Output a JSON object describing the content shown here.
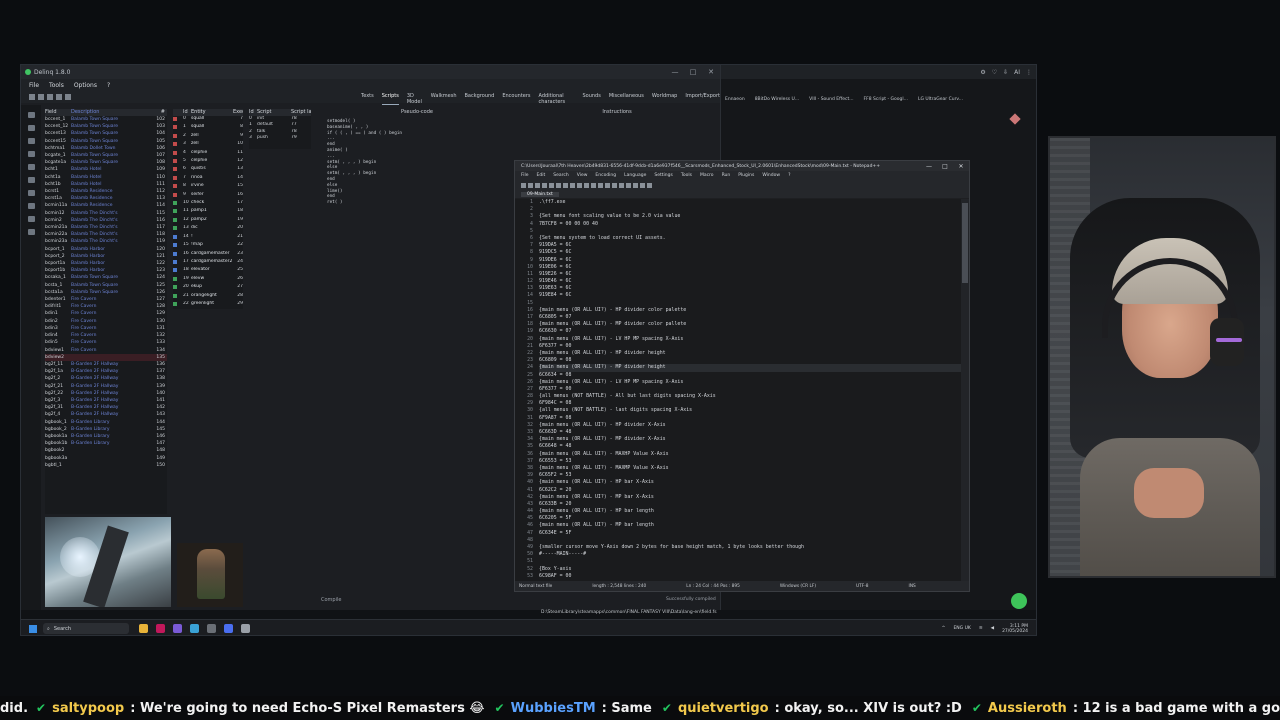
{
  "delinq": {
    "title": "Delinq 1.8.0",
    "menu": [
      "File",
      "Tools",
      "Options",
      "?"
    ],
    "tabs": [
      "Texts",
      "Scripts",
      "3D Model",
      "Walkmesh",
      "Background",
      "Encounters",
      "Additional characters",
      "Sounds",
      "Miscellaneous",
      "Worldmap",
      "Import/Export"
    ],
    "list1_headers": [
      "Field",
      "Description",
      "#"
    ],
    "list1_rows": [
      [
        "bccent_1",
        "Balamb Town Square",
        "102"
      ],
      [
        "bccent_12",
        "Balamb Town Square",
        "103"
      ],
      [
        "bccent13",
        "Balamb Town Square",
        "104"
      ],
      [
        "bccent15",
        "Balamb Town Square",
        "105"
      ],
      [
        "bchtma1",
        "Balamb Dollet Town",
        "106"
      ],
      [
        "bcgate_1",
        "Balamb Town Square",
        "107"
      ],
      [
        "bcgate1a",
        "Balamb Town Square",
        "108"
      ],
      [
        "bcht1",
        "Balamb Hotel",
        "109"
      ],
      [
        "bcht1a",
        "Balamb Hotel",
        "110"
      ],
      [
        "bcht1b",
        "Balamb Hotel",
        "111"
      ],
      [
        "bcrst1",
        "Balamb Residence",
        "112"
      ],
      [
        "bcrst1a",
        "Balamb Residence",
        "113"
      ],
      [
        "bcmin11a",
        "Balamb Residence",
        "114"
      ],
      [
        "bcmin12",
        "Balamb The Dincht's",
        "115"
      ],
      [
        "bcmin2",
        "Balamb The Dincht's",
        "116"
      ],
      [
        "bcmin21a",
        "Balamb The Dincht's",
        "117"
      ],
      [
        "bcmin22a",
        "Balamb The Dincht's",
        "118"
      ],
      [
        "bcmin23a",
        "Balamb The Dincht's",
        "119"
      ],
      [
        "bcport_1",
        "Balamb Harbor",
        "120"
      ],
      [
        "bcport_2",
        "Balamb Harbor",
        "121"
      ],
      [
        "bcport1a",
        "Balamb Harbor",
        "122"
      ],
      [
        "bcport1b",
        "Balamb Harbor",
        "123"
      ],
      [
        "bcsaka_1",
        "Balamb Town Square",
        "124"
      ],
      [
        "bcsta_1",
        "Balamb Town Square",
        "125"
      ],
      [
        "bcsta1a",
        "Balamb Town Square",
        "126"
      ],
      [
        "bdenter1",
        "Fire Cavern",
        "127"
      ],
      [
        "bdifrit1",
        "Fire Cavern",
        "128"
      ],
      [
        "bdin1",
        "Fire Cavern",
        "129"
      ],
      [
        "bdin2",
        "Fire Cavern",
        "130"
      ],
      [
        "bdin3",
        "Fire Cavern",
        "131"
      ],
      [
        "bdin4",
        "Fire Cavern",
        "132"
      ],
      [
        "bdin5",
        "Fire Cavern",
        "133"
      ],
      [
        "bdview1",
        "Fire Cavern",
        "134"
      ],
      [
        "bdview2",
        "",
        "135"
      ],
      [
        "bg2f_11",
        "B-Garden 2F Hallway",
        "136"
      ],
      [
        "bg2f_1a",
        "B-Garden 2F Hallway",
        "137"
      ],
      [
        "bg2f_2",
        "B-Garden 2F Hallway",
        "138"
      ],
      [
        "bg2f_21",
        "B-Garden 2F Hallway",
        "139"
      ],
      [
        "bg2f_22",
        "B-Garden 2F Hallway",
        "140"
      ],
      [
        "bg2f_3",
        "B-Garden 2F Hallway",
        "141"
      ],
      [
        "bg2f_31",
        "B-Garden 2F Hallway",
        "142"
      ],
      [
        "bg2f_4",
        "B-Garden 2F Hallway",
        "143"
      ],
      [
        "bgbook_1",
        "B-Garden Library",
        "144"
      ],
      [
        "bgbook_2",
        "B-Garden Library",
        "145"
      ],
      [
        "bgbook1a",
        "B-Garden Library",
        "146"
      ],
      [
        "bgbook1b",
        "B-Garden Library",
        "147"
      ],
      [
        "bgbook2",
        "",
        "148"
      ],
      [
        "bgbook3a",
        "",
        "149"
      ],
      [
        "bgbtl_1",
        "",
        "150"
      ]
    ],
    "list2_headers": [
      "Id",
      "Entity",
      "Exec"
    ],
    "list2_rows": [
      [
        "r",
        "0",
        "squall",
        "7"
      ],
      [
        "r",
        "1",
        "squall",
        "8"
      ],
      [
        "r",
        "2",
        "zell",
        "9"
      ],
      [
        "r",
        "3",
        "zell",
        "10"
      ],
      [
        "r",
        "4",
        "celphie",
        "11"
      ],
      [
        "r",
        "5",
        "celphie",
        "12"
      ],
      [
        "r",
        "6",
        "quistis",
        "13"
      ],
      [
        "r",
        "7",
        "rinoa",
        "14"
      ],
      [
        "r",
        "8",
        "irvine",
        "15"
      ],
      [
        "r",
        "9",
        "seifer",
        "16"
      ],
      [
        "g",
        "10",
        "check",
        "17"
      ],
      [
        "g",
        "11",
        "pamp1",
        "18"
      ],
      [
        "g",
        "12",
        "pamp2",
        "19"
      ],
      [
        "g",
        "13",
        "dic",
        "20"
      ],
      [
        "b",
        "14",
        "!",
        "21"
      ],
      [
        "b",
        "15",
        "!map",
        "22"
      ],
      [
        "b",
        "16",
        "cardgamemaster",
        "23"
      ],
      [
        "b",
        "17",
        "cardgamemaster2",
        "24"
      ],
      [
        "b",
        "18",
        "elevator",
        "25"
      ],
      [
        "g",
        "19",
        "elevw",
        "26"
      ],
      [
        "g",
        "20",
        "ekup",
        "27"
      ],
      [
        "g",
        "21",
        "orangelight",
        "28"
      ],
      [
        "g",
        "22",
        "greenlight",
        "29"
      ],
      [
        "g",
        "23",
        "elvtexe",
        "30"
      ]
    ],
    "list3_headers": [
      "Id",
      "Script",
      "Script label"
    ],
    "list3_rows": [
      [
        "0",
        "init",
        "78"
      ],
      [
        "1",
        "default",
        "77"
      ],
      [
        "2",
        "talk",
        "78"
      ],
      [
        "3",
        "push",
        "79"
      ]
    ],
    "panel_headers": [
      "Pseudo-code",
      "Instructions"
    ],
    "pseudo_lines": [
      "setmodel( )",
      "baseanime( , , )",
      "if ( ( , ) == ) and ( )  begin",
      "   ...",
      "end",
      "  anime( )",
      "  ...",
      "    setm( , , , )  begin",
      "    else",
      "    setm( , , , )  begin",
      "  end",
      "  else",
      "  lime()",
      "end",
      "ret( )"
    ],
    "compile_label": "Compile",
    "path_status": "Successfully compiled",
    "path": "D:\\SteamLibrary\\steamapps\\common\\FINAL FANTASY VIII\\Data\\lang-en\\field.fs"
  },
  "browser": {
    "bookmarks": [
      "Ennaeon",
      "8BitDo Wireless U...",
      "VIII - Sound Effect...",
      "FF8 Script - Googl...",
      "LG UltraGear Curv..."
    ]
  },
  "notepad": {
    "title": "C:\\Users\\Jouraal\\7th Heaven\\2b49d831-6556-41df-9dcb-d1a6e937f546__Scarsmods_Enhanced_Stock_UI_2.0601\\EnhancedStock\\mod\\09-Main.txt - Notepad++",
    "menu": [
      "File",
      "Edit",
      "Search",
      "View",
      "Encoding",
      "Language",
      "Settings",
      "Tools",
      "Macro",
      "Run",
      "Plugins",
      "Window",
      "?"
    ],
    "tab": "09-Main.txt",
    "lines": [
      ".\\ff7.exe",
      "",
      "{Set menu font scaling value to be 2.0 via value",
      "7B7CF8 = 00 00 00 40",
      "",
      "{Set menu system to load correct UI assets.",
      "919DA5 = 6C",
      "919DC5 = 6C",
      "919DE6 = 6C",
      "919E06 = 6C",
      "919E26 = 6C",
      "919E46 = 6C",
      "919E63 = 6C",
      "919E84 = 6C",
      "",
      "{main menu (OR ALL UI?) - HP divider color palette",
      "6C6805 = 07",
      "{main menu (OR ALL UI?) - MP divider color pallete",
      "6C6630 = 07",
      "{main menu (OR ALL UI?) - LV HP MP spacing X-Axis",
      "6F6377 = 00",
      "{main menu (OR ALL UI?) - HP divider height",
      "6C6809 = 08",
      "{main menu (OR ALL UI?) - MP divider height",
      "6C6634 = 08",
      "{main menu (OR ALL UI?) - LV HP MP spacing X-Axis",
      "6F6377 = 00",
      "{all menus (NOT BATTLE) - All but last digits spacing X-Axis",
      "6F984C = 08",
      "{all menus (NOT BATTLE) - last digits spacing X-Axis",
      "6F9A87 = 08",
      "{main menu (OR ALL UI?) - HP divider X-Axis",
      "6C663D = 48",
      "{main menu (OR ALL UI?) - MP divider X-Axis",
      "6C6648 = 48",
      "{main menu (OR ALL UI?) - MAXHP Value X-Axis",
      "6C6553 = 53",
      "{main menu (OR ALL UI?) - MAXMP Value X-Axis",
      "6C65F2 = 53",
      "{main menu (OR ALL UI?) - HP bar X-Axis",
      "6C62C2 = 20",
      "{main menu (OR ALL UI?) - MP bar X-Axis",
      "6C633B = 20",
      "{main menu (OR ALL UI?) - HP bar length",
      "6C6205 = 5F",
      "{main menu (OR ALL UI?) - MP bar length",
      "6C634E = 5F",
      "",
      "{smaller cursor move Y-Axis down 2 bytes for base height match, 1 byte looks better though",
      "#-----MAIN-----#",
      "",
      "{Box Y-axis",
      "6C98AF = 00"
    ],
    "cursor_line": 24,
    "status": [
      "Normal text file",
      "length : 2,548   lines : 240",
      "Ln : 24   Col : 44   Pos : 895",
      "Windows (CR LF)",
      "UTF-8",
      "INS"
    ]
  },
  "taskbar": {
    "search": "Search",
    "lang": "ENG\nUK",
    "time": "3:11 PM",
    "date": "27/05/2024"
  },
  "ticker": {
    "lead": "did.",
    "messages": [
      {
        "user": "saltypoop",
        "text": ": We're going to need Echo-S Pixel Remasters 😂",
        "blue": false
      },
      {
        "user": "WubbiesTM",
        "text": ": Same",
        "blue": true
      },
      {
        "user": "quietvertigo",
        "text": ": okay, so... XIV is out? :D",
        "blue": false
      },
      {
        "user": "Aussieroth",
        "text": ": 12 is a bad game with a good story.",
        "blue": false
      }
    ]
  }
}
